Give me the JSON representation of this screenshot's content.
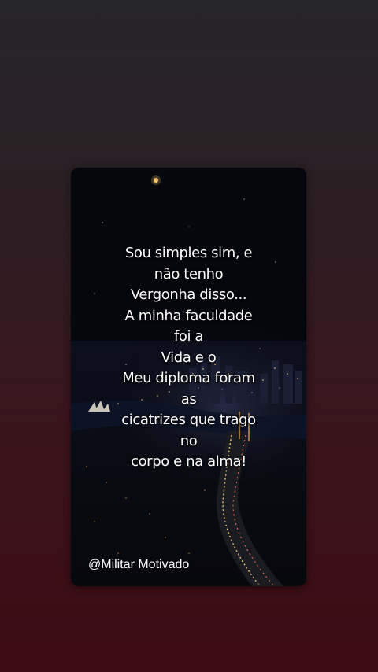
{
  "story": {
    "quote_lines": [
      "Sou simples sim, e",
      "não tenho",
      "Vergonha disso...",
      "A minha faculdade",
      "foi a",
      "Vida e o",
      "Meu diploma foram",
      "as",
      "cicatrizes que trago",
      "no",
      "corpo e na alma!"
    ],
    "watermark": "@Militar Motivado"
  },
  "background_image": "night-city-aerial-photo",
  "colors": {
    "page_top": "#262528",
    "page_bottom": "#3d0b12",
    "text": "#ffffff"
  }
}
